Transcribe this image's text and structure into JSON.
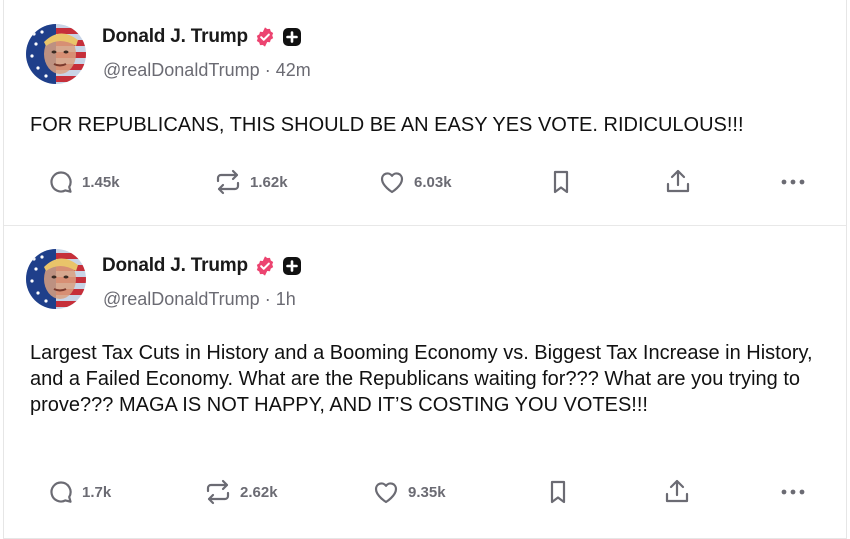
{
  "posts": [
    {
      "author_name": "Donald J. Trump",
      "handle": "@realDonaldTrump",
      "separator": "·",
      "time": "42m",
      "text": "FOR REPUBLICANS, THIS SHOULD BE AN EASY YES VOTE. RIDICULOUS!!!",
      "replies": "1.45k",
      "reposts": "1.62k",
      "likes": "6.03k"
    },
    {
      "author_name": "Donald J. Trump",
      "handle": "@realDonaldTrump",
      "separator": "·",
      "time": "1h",
      "text": "Largest Tax Cuts in History and a Booming Economy vs. Biggest Tax Increase in History, and a Failed Economy. What are the Republicans waiting for??? What are you trying to prove??? MAGA IS NOT HAPPY, AND IT’S COSTING YOU VOTES!!!",
      "replies": "1.7k",
      "reposts": "2.62k",
      "likes": "9.35k"
    }
  ],
  "colors": {
    "verified_badge": "#ec4470",
    "muted_text": "#6b6b73",
    "divider": "#e8e8e8"
  },
  "icons": [
    "reply-icon",
    "repost-icon",
    "like-icon",
    "bookmark-icon",
    "share-icon",
    "more-icon",
    "verified-badge-icon",
    "plus-badge-icon"
  ]
}
